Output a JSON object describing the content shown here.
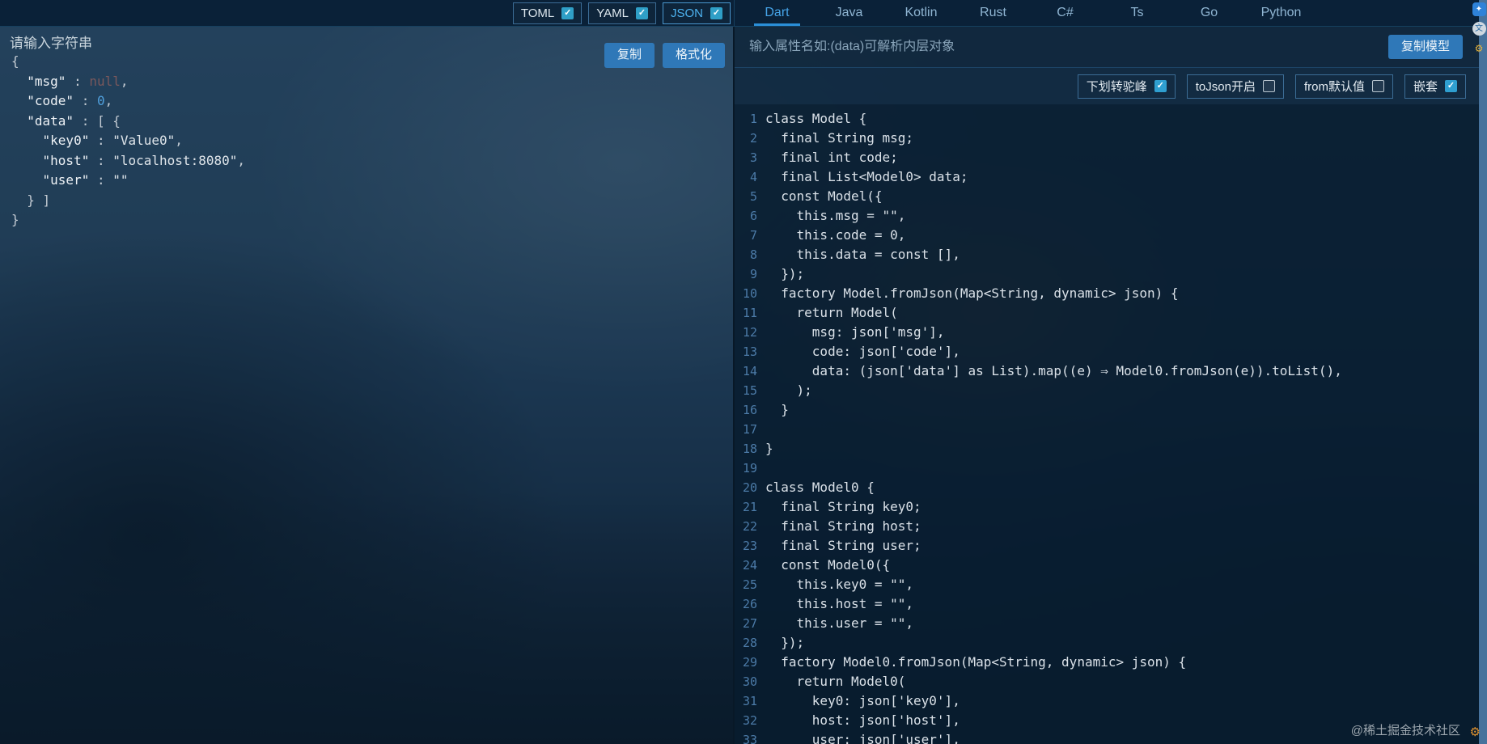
{
  "topbar": {
    "format_toggles": [
      {
        "label": "TOML",
        "checked": true,
        "active": false
      },
      {
        "label": "YAML",
        "checked": true,
        "active": false
      },
      {
        "label": "JSON",
        "checked": true,
        "active": true
      }
    ],
    "lang_tabs": [
      {
        "label": "Dart",
        "active": true
      },
      {
        "label": "Java",
        "active": false
      },
      {
        "label": "Kotlin",
        "active": false
      },
      {
        "label": "Rust",
        "active": false
      },
      {
        "label": "C#",
        "active": false
      },
      {
        "label": "Ts",
        "active": false
      },
      {
        "label": "Go",
        "active": false
      },
      {
        "label": "Python",
        "active": false
      }
    ]
  },
  "left_panel": {
    "title": "请输入字符串",
    "copy_button": "复制",
    "format_button": "格式化",
    "json_lines": [
      [
        {
          "t": "{",
          "c": "p"
        }
      ],
      [
        {
          "t": "  ",
          "c": "p"
        },
        {
          "t": "\"msg\"",
          "c": "k"
        },
        {
          "t": " : ",
          "c": "p"
        },
        {
          "t": "null",
          "c": "u"
        },
        {
          "t": ",",
          "c": "p"
        }
      ],
      [
        {
          "t": "  ",
          "c": "p"
        },
        {
          "t": "\"code\"",
          "c": "k"
        },
        {
          "t": " : ",
          "c": "p"
        },
        {
          "t": "0",
          "c": "n"
        },
        {
          "t": ",",
          "c": "p"
        }
      ],
      [
        {
          "t": "  ",
          "c": "p"
        },
        {
          "t": "\"data\"",
          "c": "k"
        },
        {
          "t": " : [ {",
          "c": "p"
        }
      ],
      [
        {
          "t": "    ",
          "c": "p"
        },
        {
          "t": "\"key0\"",
          "c": "k"
        },
        {
          "t": " : ",
          "c": "p"
        },
        {
          "t": "\"Value0\"",
          "c": "s"
        },
        {
          "t": ",",
          "c": "p"
        }
      ],
      [
        {
          "t": "    ",
          "c": "p"
        },
        {
          "t": "\"host\"",
          "c": "k"
        },
        {
          "t": " : ",
          "c": "p"
        },
        {
          "t": "\"localhost:8080\"",
          "c": "s"
        },
        {
          "t": ",",
          "c": "p"
        }
      ],
      [
        {
          "t": "    ",
          "c": "p"
        },
        {
          "t": "\"user\"",
          "c": "k"
        },
        {
          "t": " : ",
          "c": "p"
        },
        {
          "t": "\"\"",
          "c": "s"
        }
      ],
      [
        {
          "t": "  } ]",
          "c": "p"
        }
      ],
      [
        {
          "t": "}",
          "c": "p"
        }
      ]
    ]
  },
  "right_panel": {
    "prop_input_placeholder": "输入属性名如:(data)可解析内层对象",
    "copy_model_button": "复制模型",
    "options": [
      {
        "label": "下划转驼峰",
        "checked": true
      },
      {
        "label": "toJson开启",
        "checked": false
      },
      {
        "label": "from默认值",
        "checked": false
      },
      {
        "label": "嵌套",
        "checked": true
      }
    ],
    "code_lines": [
      "class Model {",
      "  final String msg;",
      "  final int code;",
      "  final List<Model0> data;",
      "  const Model({",
      "    this.msg = \"\",",
      "    this.code = 0,",
      "    this.data = const [],",
      "  });",
      "  factory Model.fromJson(Map<String, dynamic> json) {",
      "    return Model(",
      "      msg: json['msg'],",
      "      code: json['code'],",
      "      data: (json['data'] as List).map((e) ⇒ Model0.fromJson(e)).toList(),",
      "    );",
      "  }",
      "",
      "}",
      "",
      "class Model0 {",
      "  final String key0;",
      "  final String host;",
      "  final String user;",
      "  const Model0({",
      "    this.key0 = \"\",",
      "    this.host = \"\",",
      "    this.user = \"\",",
      "  });",
      "  factory Model0.fromJson(Map<String, dynamic> json) {",
      "    return Model0(",
      "      key0: json['key0'],",
      "      host: json['host'],",
      "      user: json['user'],"
    ]
  },
  "right_rail": {
    "icons": [
      {
        "name": "extension-icon",
        "glyph": "✦"
      },
      {
        "name": "translate-icon",
        "glyph": "文"
      },
      {
        "name": "settings-icon",
        "glyph": "⚙"
      }
    ],
    "bottom_icon_glyph": "⚙"
  },
  "watermark": "@稀土掘金技术社区"
}
